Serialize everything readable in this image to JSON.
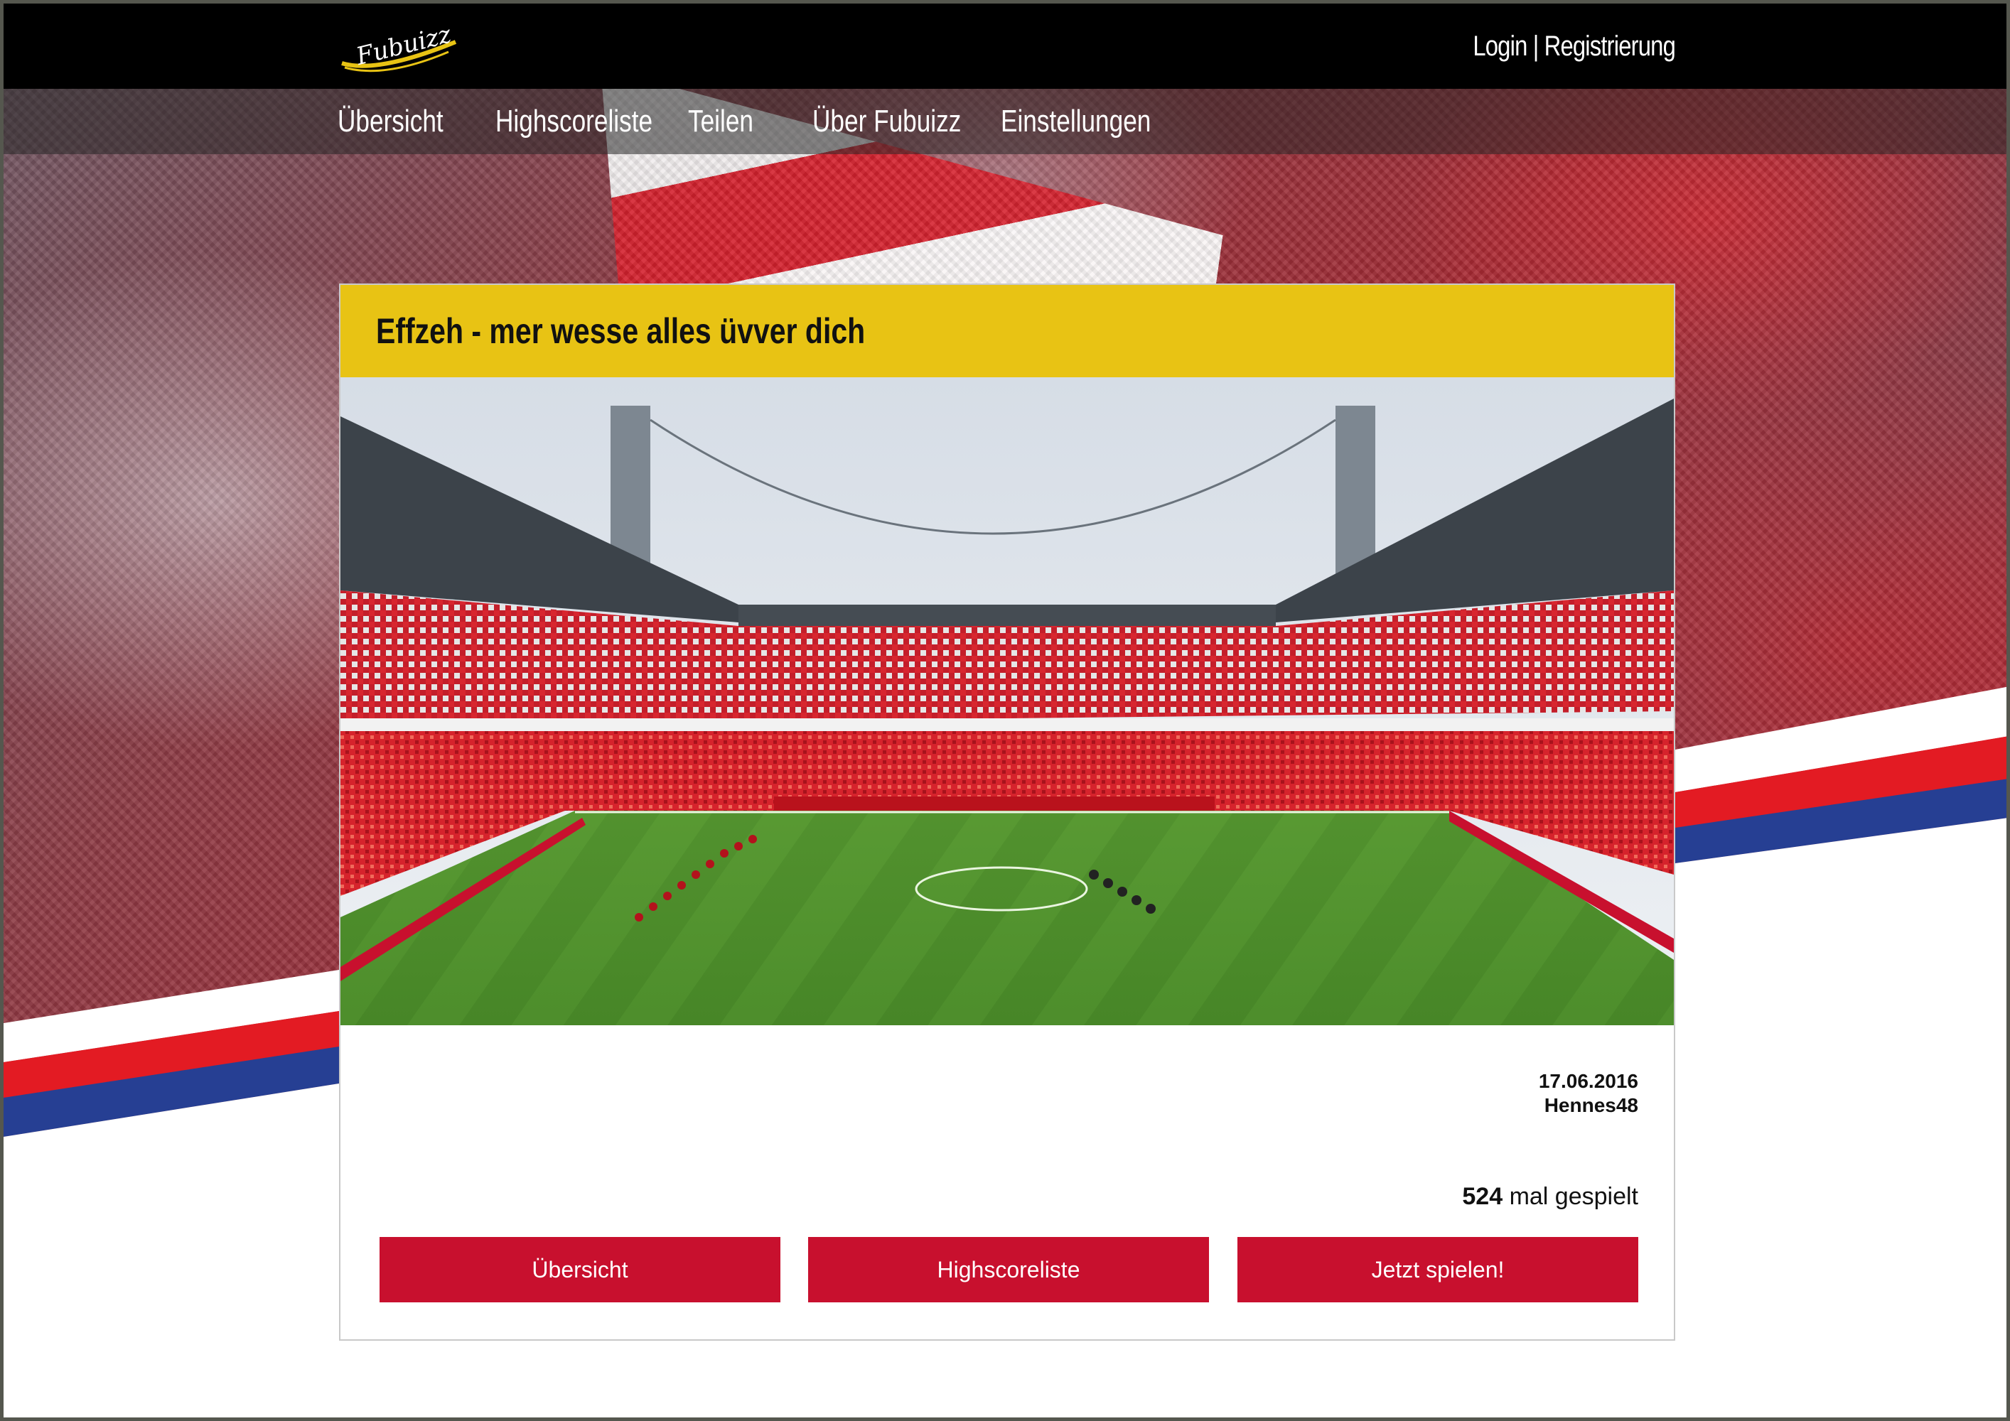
{
  "brand": {
    "logo_text": "Fubuizz"
  },
  "header": {
    "login_label": "Login",
    "separator": "|",
    "register_label": "Registrierung"
  },
  "nav": {
    "items": [
      {
        "label": "Übersicht"
      },
      {
        "label": "Highscoreliste"
      },
      {
        "label": "Teilen"
      },
      {
        "label": "Über Fubuizz"
      },
      {
        "label": "Einstellungen"
      }
    ]
  },
  "quiz": {
    "title": "Effzeh - mer wesse alles üvver dich",
    "date": "17.06.2016",
    "author": "Hennes48",
    "play_count": "524",
    "play_count_suffix": "mal gespielt",
    "actions": {
      "overview_label": "Übersicht",
      "highscore_label": "Highscoreliste",
      "play_label": "Jetzt spielen!"
    }
  },
  "colors": {
    "topbar": "#000000",
    "accent_yellow": "#e8c314",
    "button_red": "#c8102e",
    "stripe_red": "#e31b23",
    "stripe_blue": "#263f93"
  },
  "icons": {
    "logo": "fubuizz-logo-icon"
  }
}
